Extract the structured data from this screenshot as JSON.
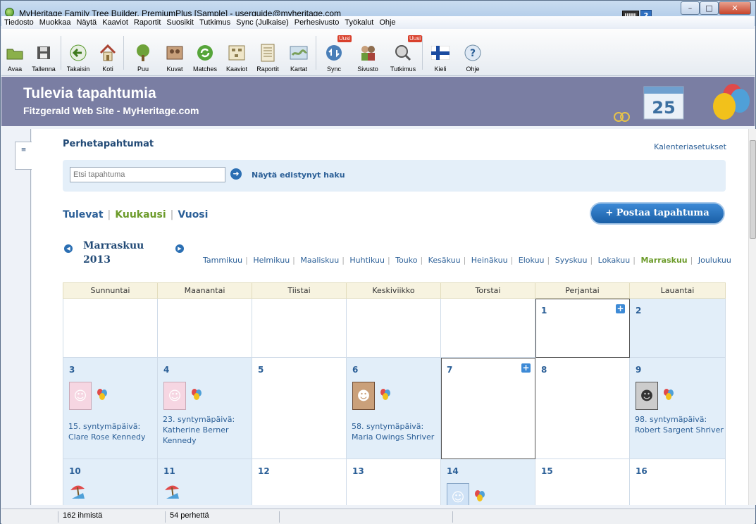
{
  "window": {
    "title": "MyHeritage Family Tree Builder, PremiumPlus [Sample] - userguide@myheritage.com"
  },
  "menu": [
    "Tiedosto",
    "Muokkaa",
    "Näytä",
    "Kaaviot",
    "Raportit",
    "Suosikit",
    "Tutkimus",
    "Sync (Julkaise)",
    "Perhesivusto",
    "Työkalut",
    "Ohje"
  ],
  "toolbar": [
    {
      "label": "Avaa",
      "icon": "folder-icon"
    },
    {
      "label": "Tallenna",
      "icon": "save-icon"
    },
    {
      "label": "Takaisin",
      "icon": "back-arrow-icon"
    },
    {
      "label": "Koti",
      "icon": "home-icon"
    },
    {
      "label": "Puu",
      "icon": "tree-icon"
    },
    {
      "label": "Kuvat",
      "icon": "photos-icon"
    },
    {
      "label": "Matches",
      "icon": "matches-icon"
    },
    {
      "label": "Kaaviot",
      "icon": "charts-icon"
    },
    {
      "label": "Raportit",
      "icon": "reports-icon"
    },
    {
      "label": "Kartat",
      "icon": "maps-icon"
    },
    {
      "label": "Sync",
      "icon": "sync-icon",
      "badge": "Uusi"
    },
    {
      "label": "Sivusto",
      "icon": "website-icon"
    },
    {
      "label": "Tutkimus",
      "icon": "research-icon",
      "badge": "Uusi"
    },
    {
      "label": "Kieli",
      "icon": "finland-flag-icon"
    },
    {
      "label": "Ohje",
      "icon": "help-icon"
    }
  ],
  "banner": {
    "title": "Tulevia tapahtumia",
    "subtitle": "Fitzgerald Web Site - MyHeritage.com",
    "calendar_day": "25"
  },
  "page": {
    "heading": "Perhetapahtumat",
    "settings_link": "Kalenteriasetukset",
    "search_placeholder": "Etsi tapahtuma",
    "advanced_search": "Näytä edistynyt haku",
    "views": [
      "Tulevat",
      "Kuukausi",
      "Vuosi"
    ],
    "post_button": "+ Postaa tapahtuma",
    "current_month": "Marraskuu",
    "current_year": "2013",
    "months": [
      "Tammikuu",
      "Helmikuu",
      "Maaliskuu",
      "Huhtikuu",
      "Touko",
      "Kesäkuu",
      "Heinäkuu",
      "Elokuu",
      "Syyskuu",
      "Lokakuu",
      "Marraskuu",
      "Joulukuu"
    ],
    "weekdays": [
      "Sunnuntai",
      "Maanantai",
      "Tiistai",
      "Keskiviikko",
      "Torstai",
      "Perjantai",
      "Lauantai"
    ]
  },
  "calendar": {
    "row1": [
      {
        "day": ""
      },
      {
        "day": ""
      },
      {
        "day": ""
      },
      {
        "day": ""
      },
      {
        "day": ""
      },
      {
        "day": "1",
        "plus": true
      },
      {
        "day": "2"
      }
    ],
    "row2": [
      {
        "day": "3",
        "event": "15. syntymäpäivä: Clare Rose Kennedy",
        "avatar": "female-silhouette"
      },
      {
        "day": "4",
        "event": "23. syntymäpäivä: Katherine Berner Kennedy",
        "avatar": "female-silhouette"
      },
      {
        "day": "5"
      },
      {
        "day": "6",
        "event": "58. syntymäpäivä: Maria Owings Shriver",
        "avatar": "photo-woman"
      },
      {
        "day": "7",
        "plus": true,
        "today": true
      },
      {
        "day": "8"
      },
      {
        "day": "9",
        "event": "98. syntymäpäivä: Robert Sargent Shriver",
        "avatar": "photo-man"
      }
    ],
    "row3": [
      {
        "day": "10",
        "icon": "beach-chair-icon"
      },
      {
        "day": "11",
        "icon": "beach-chair-icon"
      },
      {
        "day": "12"
      },
      {
        "day": "13"
      },
      {
        "day": "14",
        "avatar": "male-silhouette"
      },
      {
        "day": "15"
      },
      {
        "day": "16"
      }
    ]
  },
  "status": {
    "people": "162 ihmistä",
    "families": "54 perhettä"
  }
}
